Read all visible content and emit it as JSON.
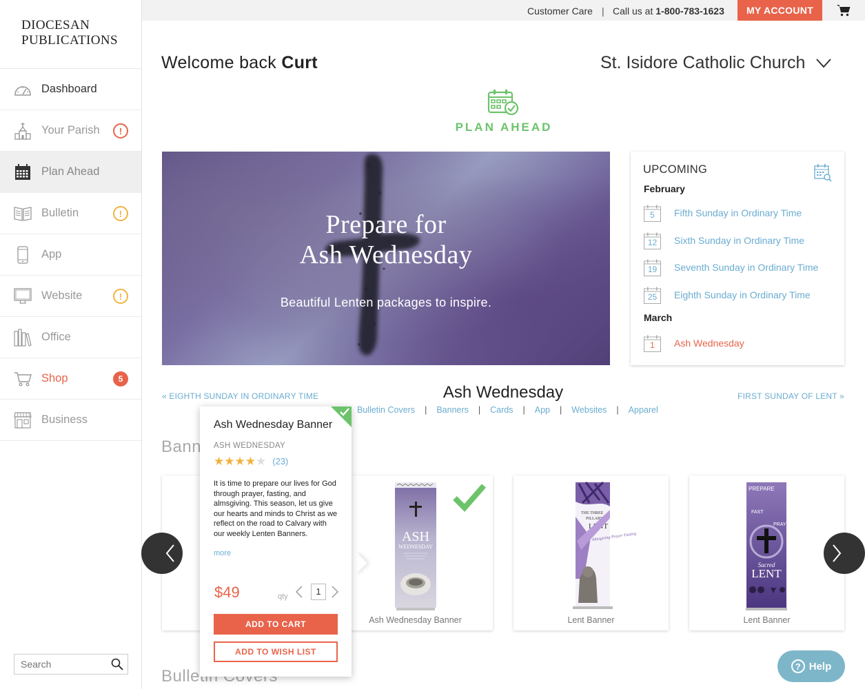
{
  "brand": {
    "line1": "DIOCESAN",
    "line2": "PUBLICATIONS"
  },
  "sidebar": {
    "items": [
      {
        "label": "Dashboard",
        "icon": "gauge-icon"
      },
      {
        "label": "Your Parish",
        "icon": "church-icon",
        "badge": "!"
      },
      {
        "label": "Plan Ahead",
        "icon": "calendar-icon"
      },
      {
        "label": "Bulletin",
        "icon": "book-icon",
        "badge": "!"
      },
      {
        "label": "App",
        "icon": "phone-icon"
      },
      {
        "label": "Website",
        "icon": "monitor-icon",
        "badge": "!"
      },
      {
        "label": "Office",
        "icon": "books-icon"
      },
      {
        "label": "Shop",
        "icon": "cart-icon",
        "badge": "5"
      },
      {
        "label": "Business",
        "icon": "storefront-icon"
      }
    ],
    "search_placeholder": "Search"
  },
  "topbar": {
    "customer_care": "Customer Care",
    "separator": "|",
    "call_prefix": "Call us at",
    "phone": "1-800-783-1623",
    "my_account": "MY ACCOUNT"
  },
  "welcome": {
    "prefix": "Welcome back",
    "name": "Curt"
  },
  "parish": "St. Isidore Catholic Church",
  "plan_ahead_title": "PLAN AHEAD",
  "hero": {
    "title_line1": "Prepare for",
    "title_line2": "Ash Wednesday",
    "subtitle": "Beautiful Lenten packages to inspire."
  },
  "upcoming": {
    "title": "UPCOMING",
    "months": [
      {
        "name": "February",
        "events": [
          {
            "day": "5",
            "name": "Fifth Sunday in Ordinary Time"
          },
          {
            "day": "12",
            "name": "Sixth Sunday in Ordinary Time"
          },
          {
            "day": "19",
            "name": "Seventh Sunday in Ordinary Time"
          },
          {
            "day": "25",
            "name": "Eighth Sunday in Ordinary Time"
          }
        ]
      },
      {
        "name": "March",
        "events": [
          {
            "day": "1",
            "name": "Ash Wednesday"
          }
        ]
      }
    ]
  },
  "liturgy_nav": {
    "prev": "« EIGHTH SUNDAY IN ORDINARY TIME",
    "current": "Ash Wednesday",
    "next": "FIRST SUNDAY OF LENT »",
    "categories": [
      "Bulletin Covers",
      "Banners",
      "Cards",
      "App",
      "Websites",
      "Apparel"
    ]
  },
  "sections": {
    "banners": "Banners",
    "bulletin_covers": "Bulletin Covers"
  },
  "products": [
    {
      "label": "Ash Wednesday Banner",
      "selected": true
    },
    {
      "label": "Lent Banner"
    },
    {
      "label": "Lent Banner"
    }
  ],
  "popover": {
    "title": "Ash Wednesday Banner",
    "subtitle": "ASH WEDNESDAY",
    "rating": 4,
    "rating_max": 5,
    "review_count": "(23)",
    "description": "It is time to prepare our lives for God through prayer, fasting, and almsgiving. This season, let us give our hearts and minds to Christ as we reflect on the road to Calvary with our weekly Lenten Banners.",
    "more": "more",
    "price": "$49",
    "qty_label": "qty",
    "qty": "1",
    "add_to_cart": "ADD TO CART",
    "add_to_wish_list": "ADD TO WISH LIST"
  },
  "banner_texts": {
    "ash_main": "ASH",
    "ash_second": "WEDNESDAY",
    "lent1_top": "THE THREE",
    "lent1_mid": "PILLARS OF",
    "lent1_main": "LENT",
    "lent1_words": "Almsgiving Prayer Fasting",
    "lent2_top": "PREPARE",
    "lent2_fast": "FAST",
    "lent2_pray": "PRAY",
    "lent2_sacred": "Sacred",
    "lent2_main": "LENT"
  },
  "help": {
    "label": "Help",
    "q": "?"
  },
  "colors": {
    "accent": "#e8634a",
    "green": "#6cc36a",
    "link": "#6aacd0",
    "warning": "#f2b33d"
  }
}
